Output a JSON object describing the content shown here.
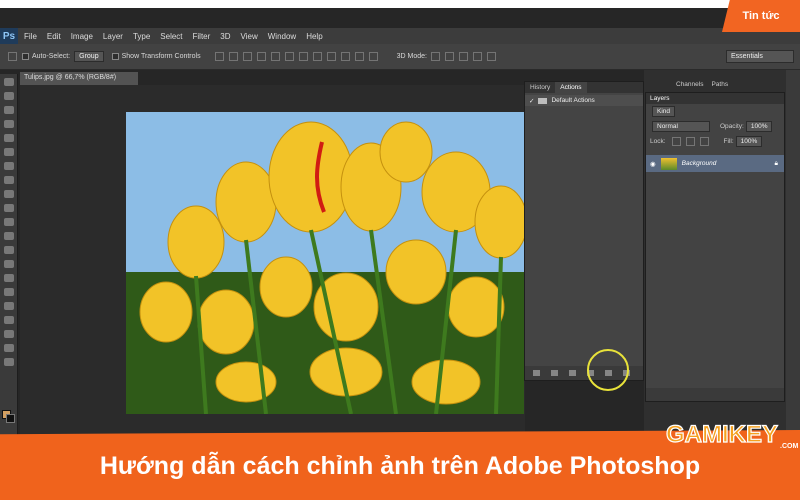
{
  "banner": {
    "badge": "Tin tức"
  },
  "app": {
    "logo": "Ps",
    "menu": [
      "File",
      "Edit",
      "Image",
      "Layer",
      "Type",
      "Select",
      "Filter",
      "3D",
      "View",
      "Window",
      "Help"
    ],
    "options": {
      "auto_select_label": "Auto-Select:",
      "auto_select_value": "Group",
      "transform_label": "Show Transform Controls",
      "mode_3d": "3D Mode:",
      "workspace": "Essentials"
    },
    "document_tab": "Tulips.jpg @ 66,7% (RGB/8#)",
    "actions_panel": {
      "tabs": [
        "History",
        "Actions"
      ],
      "active_tab": "Actions",
      "items": [
        "Default Actions"
      ]
    },
    "layers_panel": {
      "top_tabs": [
        "Channels",
        "Paths"
      ],
      "title": "Layers",
      "filter": "Kind",
      "blend_mode": "Normal",
      "opacity_label": "Opacity:",
      "opacity_value": "100%",
      "lock_label": "Lock:",
      "fill_label": "Fill:",
      "fill_value": "100%",
      "layers": [
        "Background"
      ]
    }
  },
  "footer": {
    "title": "Hướng dẫn cách chỉnh ảnh trên Adobe Photoshop",
    "brand": "GAMIKEY",
    "brand_suffix": ".COM"
  },
  "colors": {
    "accent": "#f0631c",
    "photoshop_bg": "#262626",
    "highlight_ring": "#e8e23a"
  }
}
